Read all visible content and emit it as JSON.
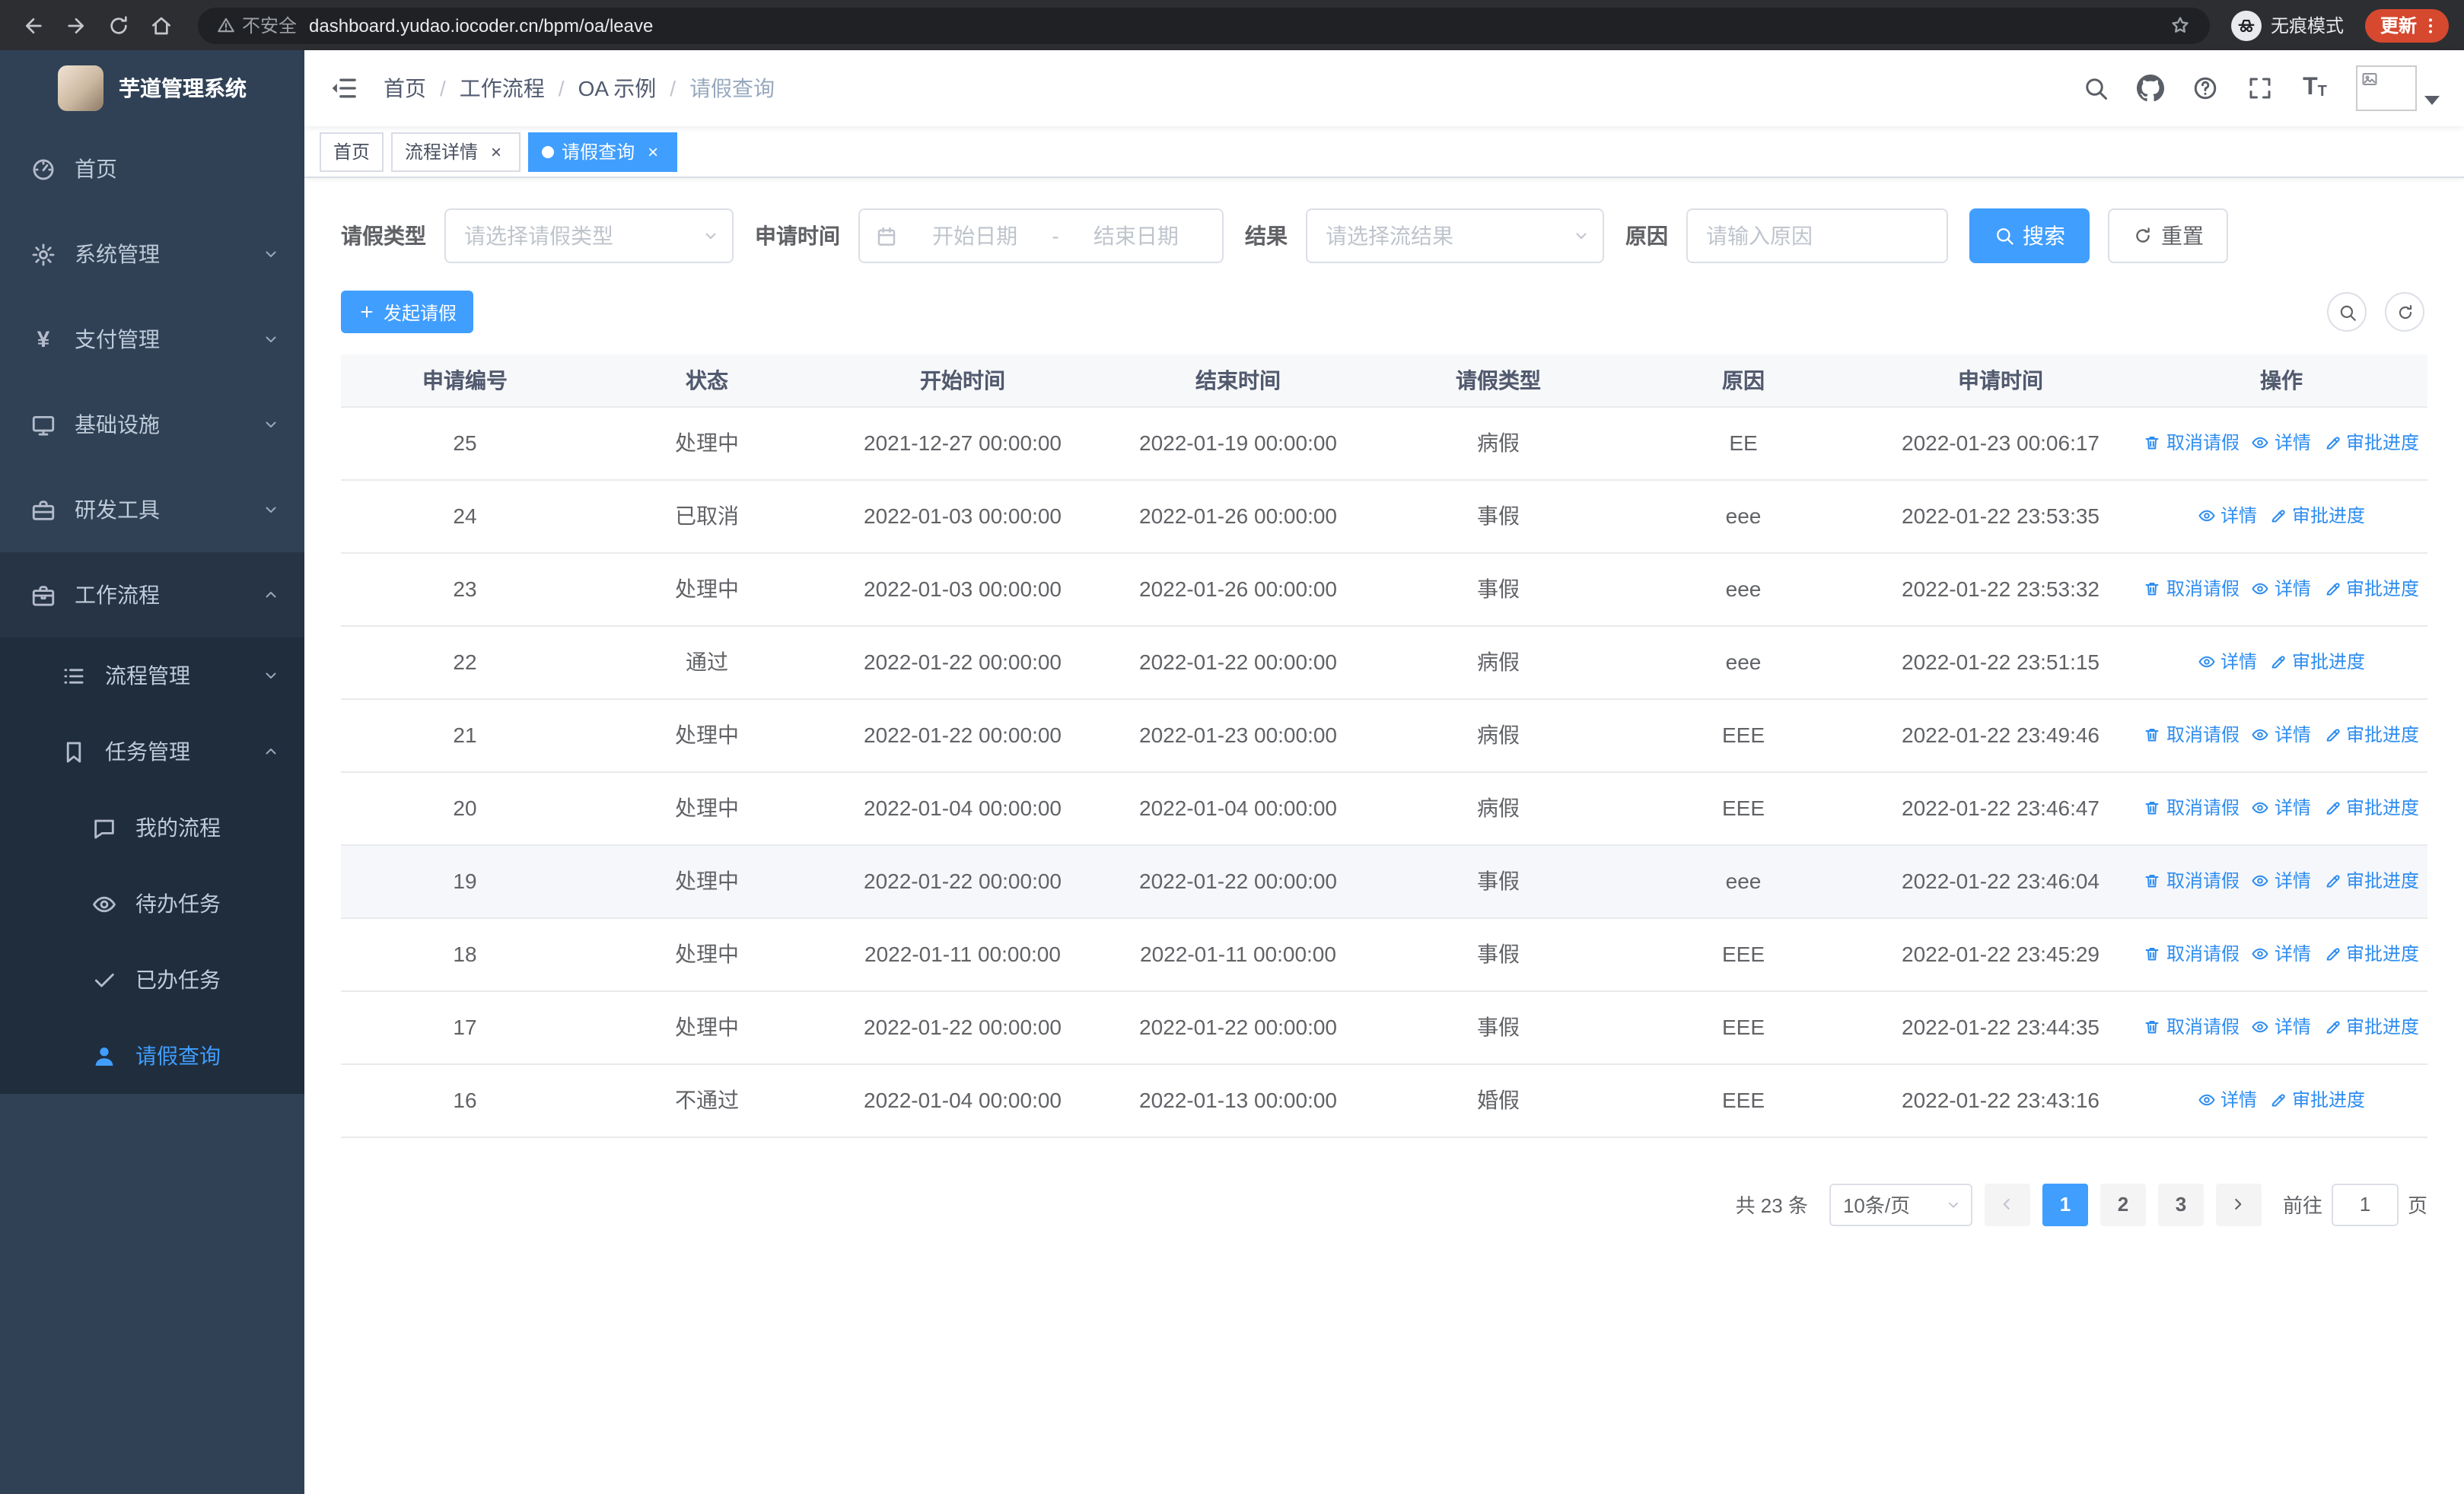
{
  "browser": {
    "nav_icons": [
      "back-icon",
      "forward-icon",
      "reload-icon",
      "home-icon"
    ],
    "security_label": "不安全",
    "url": "dashboard.yudao.iocoder.cn/bpm/oa/leave",
    "incognito_label": "无痕模式",
    "update_label": "更新"
  },
  "sidebar": {
    "logo_title": "芋道管理系统",
    "menu": [
      {
        "label": "首页",
        "icon": "gauge-icon",
        "level": 1
      },
      {
        "label": "系统管理",
        "icon": "gear-icon",
        "level": 1,
        "arrow": "down"
      },
      {
        "label": "支付管理",
        "icon": "yen-icon",
        "level": 1,
        "arrow": "down"
      },
      {
        "label": "基础设施",
        "icon": "monitor-icon",
        "level": 1,
        "arrow": "down"
      },
      {
        "label": "研发工具",
        "icon": "toolbox-icon",
        "level": 1,
        "arrow": "down"
      },
      {
        "label": "工作流程",
        "icon": "briefcase-icon",
        "level": 1,
        "arrow": "up",
        "open": true
      },
      {
        "label": "流程管理",
        "icon": "flow-icon",
        "level": 2,
        "arrow": "down",
        "sub": true
      },
      {
        "label": "任务管理",
        "icon": "tasks-icon",
        "level": 2,
        "arrow": "up",
        "open": true,
        "sub": true
      },
      {
        "label": "我的流程",
        "icon": "chat-icon",
        "level": 3,
        "sub": true
      },
      {
        "label": "待办任务",
        "icon": "eye-icon",
        "level": 3,
        "sub": true
      },
      {
        "label": "已办任务",
        "icon": "check-icon",
        "level": 3,
        "sub": true
      },
      {
        "label": "请假查询",
        "icon": "user-icon",
        "level": 3,
        "sub": true,
        "active": true
      }
    ]
  },
  "header": {
    "breadcrumb": [
      "首页",
      "工作流程",
      "OA 示例",
      "请假查询"
    ],
    "icons": [
      "search-icon",
      "github-icon",
      "help-icon",
      "fullscreen-icon",
      "font-size-icon"
    ]
  },
  "tabs": [
    {
      "label": "首页",
      "closable": false,
      "active": false
    },
    {
      "label": "流程详情",
      "closable": true,
      "active": false
    },
    {
      "label": "请假查询",
      "closable": true,
      "active": true
    }
  ],
  "filters": {
    "leave_type_label": "请假类型",
    "leave_type_placeholder": "请选择请假类型",
    "apply_time_label": "申请时间",
    "start_placeholder": "开始日期",
    "range_separator": "-",
    "end_placeholder": "结束日期",
    "result_label": "结果",
    "result_placeholder": "请选择流结果",
    "reason_label": "原因",
    "reason_placeholder": "请输入原因",
    "search_label": "搜索",
    "reset_label": "重置"
  },
  "toolbar": {
    "create_label": "发起请假"
  },
  "table": {
    "columns": [
      "申请编号",
      "状态",
      "开始时间",
      "结束时间",
      "请假类型",
      "原因",
      "申请时间",
      "操作"
    ],
    "action_labels": {
      "cancel": "取消请假",
      "detail": "详情",
      "progress": "审批进度"
    },
    "action_icons": {
      "cancel": "trash-icon",
      "detail": "eye-icon",
      "progress": "edit-icon"
    },
    "rows": [
      {
        "id": "25",
        "status": "处理中",
        "start": "2021-12-27 00:00:00",
        "end": "2022-01-19 00:00:00",
        "type": "病假",
        "reason": "EE",
        "apply_time": "2022-01-23 00:06:17",
        "cancelable": true
      },
      {
        "id": "24",
        "status": "已取消",
        "start": "2022-01-03 00:00:00",
        "end": "2022-01-26 00:00:00",
        "type": "事假",
        "reason": "eee",
        "apply_time": "2022-01-22 23:53:35",
        "cancelable": false
      },
      {
        "id": "23",
        "status": "处理中",
        "start": "2022-01-03 00:00:00",
        "end": "2022-01-26 00:00:00",
        "type": "事假",
        "reason": "eee",
        "apply_time": "2022-01-22 23:53:32",
        "cancelable": true
      },
      {
        "id": "22",
        "status": "通过",
        "start": "2022-01-22 00:00:00",
        "end": "2022-01-22 00:00:00",
        "type": "病假",
        "reason": "eee",
        "apply_time": "2022-01-22 23:51:15",
        "cancelable": false
      },
      {
        "id": "21",
        "status": "处理中",
        "start": "2022-01-22 00:00:00",
        "end": "2022-01-23 00:00:00",
        "type": "病假",
        "reason": "EEE",
        "apply_time": "2022-01-22 23:49:46",
        "cancelable": true
      },
      {
        "id": "20",
        "status": "处理中",
        "start": "2022-01-04 00:00:00",
        "end": "2022-01-04 00:00:00",
        "type": "病假",
        "reason": "EEE",
        "apply_time": "2022-01-22 23:46:47",
        "cancelable": true
      },
      {
        "id": "19",
        "status": "处理中",
        "start": "2022-01-22 00:00:00",
        "end": "2022-01-22 00:00:00",
        "type": "事假",
        "reason": "eee",
        "apply_time": "2022-01-22 23:46:04",
        "cancelable": true,
        "highlighted": true
      },
      {
        "id": "18",
        "status": "处理中",
        "start": "2022-01-11 00:00:00",
        "end": "2022-01-11 00:00:00",
        "type": "事假",
        "reason": "EEE",
        "apply_time": "2022-01-22 23:45:29",
        "cancelable": true
      },
      {
        "id": "17",
        "status": "处理中",
        "start": "2022-01-22 00:00:00",
        "end": "2022-01-22 00:00:00",
        "type": "事假",
        "reason": "EEE",
        "apply_time": "2022-01-22 23:44:35",
        "cancelable": true
      },
      {
        "id": "16",
        "status": "不通过",
        "start": "2022-01-04 00:00:00",
        "end": "2022-01-13 00:00:00",
        "type": "婚假",
        "reason": "EEE",
        "apply_time": "2022-01-22 23:43:16",
        "cancelable": false
      }
    ]
  },
  "pagination": {
    "total": "共 23 条",
    "page_size": "10条/页",
    "pages": [
      "1",
      "2",
      "3"
    ],
    "active_page": "1",
    "goto_prefix": "前往",
    "goto_value": "1",
    "goto_suffix": "页"
  },
  "colors": {
    "primary": "#409eff",
    "link": "#2d8cf0",
    "sidebar_bg": "#304156",
    "submenu_bg": "#1f2d3d",
    "update_pill": "#d6492f"
  }
}
